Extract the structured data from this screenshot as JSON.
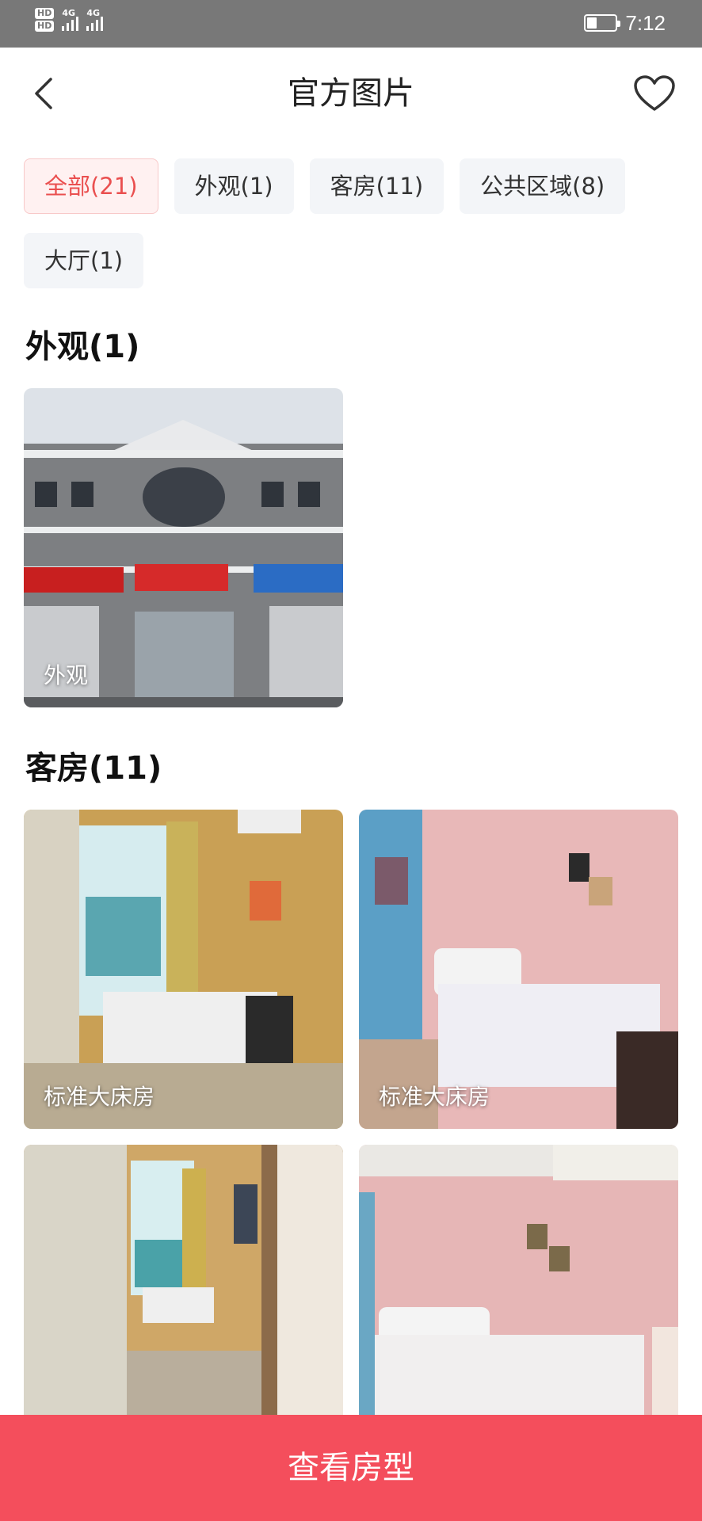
{
  "status_bar": {
    "hd1": "HD",
    "hd2": "HD",
    "signal1": "4G",
    "signal2": "4G",
    "battery_level": 0.35,
    "time": "7:12"
  },
  "header": {
    "title": "官方图片",
    "back_icon": "chevron-left-icon",
    "favorite_icon": "heart-icon"
  },
  "filters": [
    {
      "label": "全部(21)",
      "active": true
    },
    {
      "label": "外观(1)",
      "active": false
    },
    {
      "label": "客房(11)",
      "active": false
    },
    {
      "label": "公共区域(8)",
      "active": false
    },
    {
      "label": "大厅(1)",
      "active": false
    }
  ],
  "sections": [
    {
      "title": "外观(1)",
      "photos": [
        {
          "caption": "外观"
        }
      ]
    },
    {
      "title": "客房(11)",
      "photos": [
        {
          "caption": "标准大床房"
        },
        {
          "caption": "标准大床房"
        },
        {
          "caption": ""
        },
        {
          "caption": ""
        }
      ]
    }
  ],
  "footer": {
    "cta_label": "查看房型"
  },
  "colors": {
    "accent": "#f44e5c",
    "chip_active_text": "#ea4f4f",
    "status_bar_bg": "#787878"
  }
}
